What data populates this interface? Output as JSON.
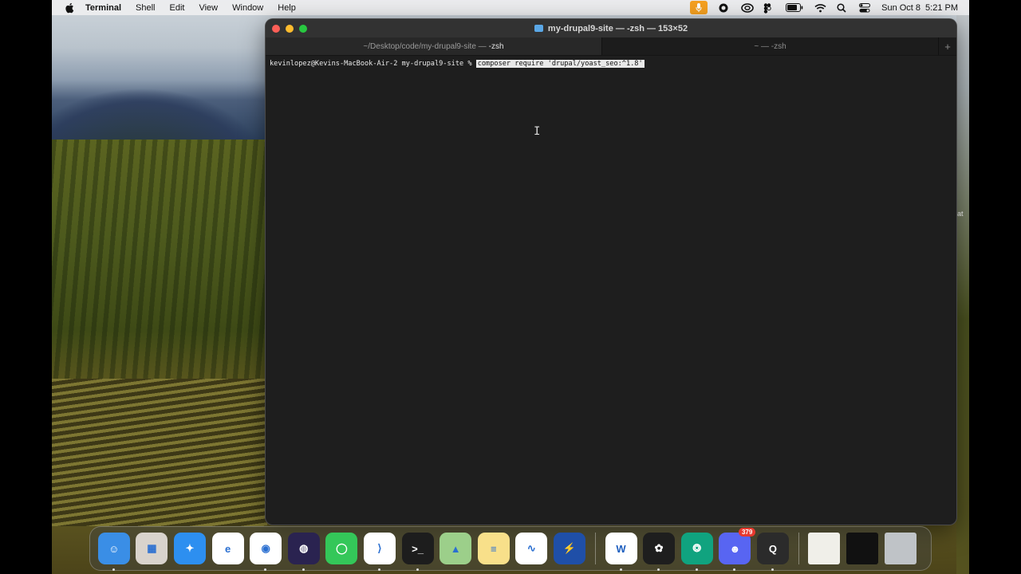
{
  "menubar": {
    "app_name": "Terminal",
    "menus": [
      "Shell",
      "Edit",
      "View",
      "Window",
      "Help"
    ],
    "date": "Sun Oct 8",
    "time": "5:21 PM"
  },
  "desktop": {
    "edge_text": "at"
  },
  "window": {
    "title": "my-drupal9-site — -zsh — 153×52",
    "tabs": [
      {
        "path": "~/Desktop/code/my-drupal9-site —",
        "shell": "-zsh"
      },
      {
        "label": "~ — -zsh"
      }
    ],
    "add_tab": "+",
    "prompt": "kevinlopez@Kevins-MacBook-Air-2 my-drupal9-site % ",
    "command": "composer require 'drupal/yoast_seo:^1.8'"
  },
  "dock": {
    "apps": [
      {
        "name": "Finder",
        "icon": "finder-icon",
        "color": "#3a8ee6",
        "glyph": "☺",
        "running": true
      },
      {
        "name": "Launchpad",
        "icon": "launchpad-icon",
        "color": "#d9d3cc",
        "glyph": "▦",
        "running": false
      },
      {
        "name": "Safari",
        "icon": "safari-icon",
        "color": "#2d8ff0",
        "glyph": "✦",
        "running": false
      },
      {
        "name": "Edge",
        "icon": "edge-icon",
        "color": "#ffffff",
        "glyph": "e",
        "running": false
      },
      {
        "name": "Chrome",
        "icon": "chrome-icon",
        "color": "#ffffff",
        "glyph": "◉",
        "running": true
      },
      {
        "name": "Firefox",
        "icon": "firefox-icon",
        "color": "#2a2350",
        "glyph": "◍",
        "running": true
      },
      {
        "name": "Messages",
        "icon": "messages-icon",
        "color": "#34c759",
        "glyph": "◯",
        "running": false
      },
      {
        "name": "VS Code",
        "icon": "vscode-icon",
        "color": "#ffffff",
        "glyph": "⟩",
        "running": true
      },
      {
        "name": "Terminal",
        "icon": "terminal-icon",
        "color": "#1d1d1d",
        "glyph": ">_",
        "running": true
      },
      {
        "name": "Maps",
        "icon": "maps-icon",
        "color": "#9ccf8a",
        "glyph": "▲",
        "running": false
      },
      {
        "name": "Notes",
        "icon": "notes-icon",
        "color": "#f8e08a",
        "glyph": "≡",
        "running": false
      },
      {
        "name": "Freeform",
        "icon": "freeform-icon",
        "color": "#ffffff",
        "glyph": "∿",
        "running": false
      },
      {
        "name": "Reeder",
        "icon": "lightning-app-icon",
        "color": "#1f4fa8",
        "glyph": "⚡",
        "running": false
      },
      {
        "name": "Word",
        "icon": "word-icon",
        "color": "#ffffff",
        "glyph": "W",
        "running": true
      },
      {
        "name": "Figma",
        "icon": "figma-icon",
        "color": "#1e1e1e",
        "glyph": "✿",
        "running": true
      },
      {
        "name": "ChatGPT",
        "icon": "chatgpt-icon",
        "color": "#10a37f",
        "glyph": "❂",
        "running": true
      },
      {
        "name": "Discord",
        "icon": "discord-icon",
        "color": "#5865f2",
        "glyph": "☻",
        "running": true,
        "badge": "379"
      },
      {
        "name": "QuickTime",
        "icon": "quicktime-icon",
        "color": "#2b2b2b",
        "glyph": "Q",
        "running": true
      }
    ],
    "stack": [
      {
        "name": "Document",
        "icon": "document-stack-icon",
        "color": "#f0efe9"
      },
      {
        "name": "Screenshot",
        "icon": "screenshot-stack-icon",
        "color": "#111111"
      },
      {
        "name": "Trash",
        "icon": "trash-icon",
        "color": "#bfc3c7"
      }
    ]
  }
}
